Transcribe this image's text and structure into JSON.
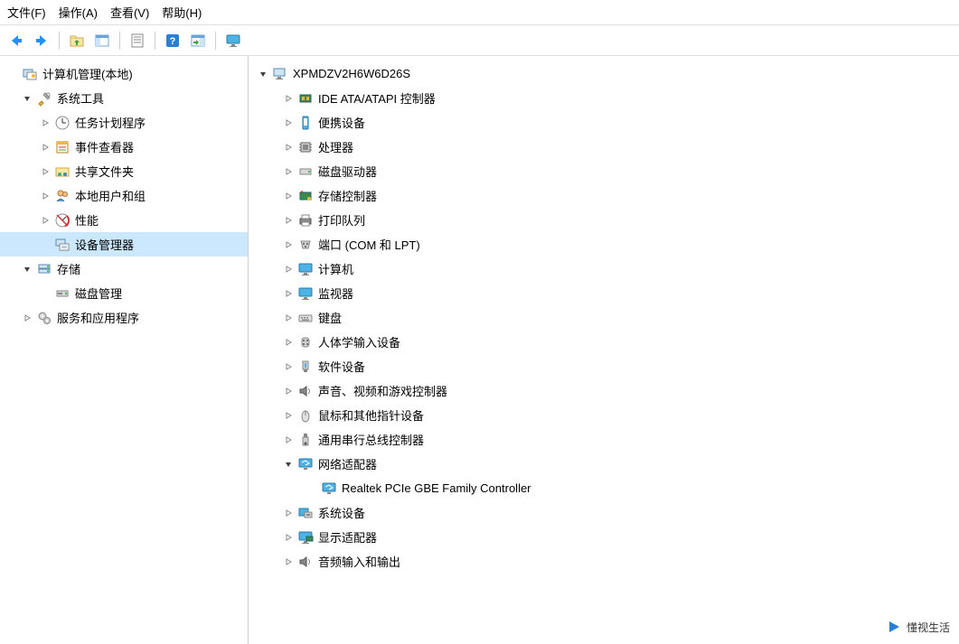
{
  "menu": {
    "file": "文件(F)",
    "action": "操作(A)",
    "view": "查看(V)",
    "help": "帮助(H)"
  },
  "toolbar": {
    "back": "back-arrow",
    "forward": "forward-arrow",
    "up": "up-folder",
    "show": "show-console",
    "prop": "properties",
    "help": "help",
    "refresh": "refresh",
    "monitor": "monitor"
  },
  "left": {
    "root": "计算机管理(本地)",
    "system_tools": "系统工具",
    "task_scheduler": "任务计划程序",
    "event_viewer": "事件查看器",
    "shared_folders": "共享文件夹",
    "local_users": "本地用户和组",
    "performance": "性能",
    "device_manager": "设备管理器",
    "storage": "存储",
    "disk_mgmt": "磁盘管理",
    "services_apps": "服务和应用程序"
  },
  "right": {
    "computer_name": "XPMDZV2H6W6D26S",
    "categories": {
      "ide": "IDE ATA/ATAPI 控制器",
      "portable": "便携设备",
      "processor": "处理器",
      "disk_drive": "磁盘驱动器",
      "storage_ctrl": "存储控制器",
      "print_queue": "打印队列",
      "ports": "端口 (COM 和 LPT)",
      "computer": "计算机",
      "monitor": "监视器",
      "keyboard": "键盘",
      "hid": "人体学输入设备",
      "software_dev": "软件设备",
      "sound": "声音、视频和游戏控制器",
      "mouse": "鼠标和其他指针设备",
      "usb": "通用串行总线控制器",
      "network": "网络适配器",
      "network_dev1": "Realtek PCIe GBE Family Controller",
      "system_dev": "系统设备",
      "display": "显示适配器",
      "audio_io": "音频输入和输出"
    }
  },
  "watermark": "懂视生活"
}
